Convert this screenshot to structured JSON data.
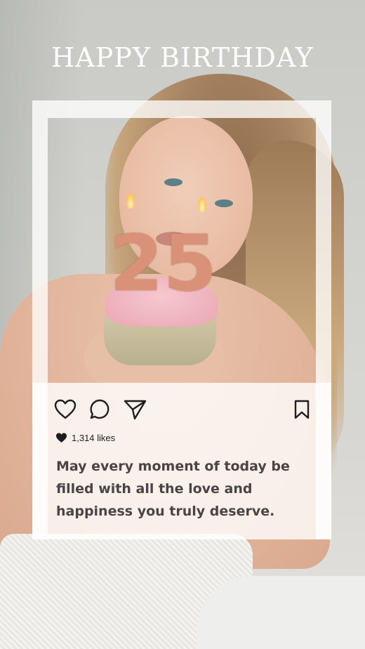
{
  "title": "HAPPY BIRTHDAY",
  "photo": {
    "subject": "woman-holding-cupcake",
    "candle_number": "25"
  },
  "post": {
    "actions": [
      {
        "name": "like",
        "icon": "heart-outline-icon"
      },
      {
        "name": "comment",
        "icon": "speech-bubble-icon"
      },
      {
        "name": "share",
        "icon": "paper-plane-icon"
      },
      {
        "name": "save",
        "icon": "bookmark-icon"
      }
    ],
    "likes_text": "1,314 likes",
    "caption": "May every moment of today be filled with all the love and happiness you truly deserve."
  },
  "colors": {
    "title": "#ffffff",
    "caption": "#4a4544",
    "icon": "#1e1e1e",
    "candle": "#d99277"
  }
}
